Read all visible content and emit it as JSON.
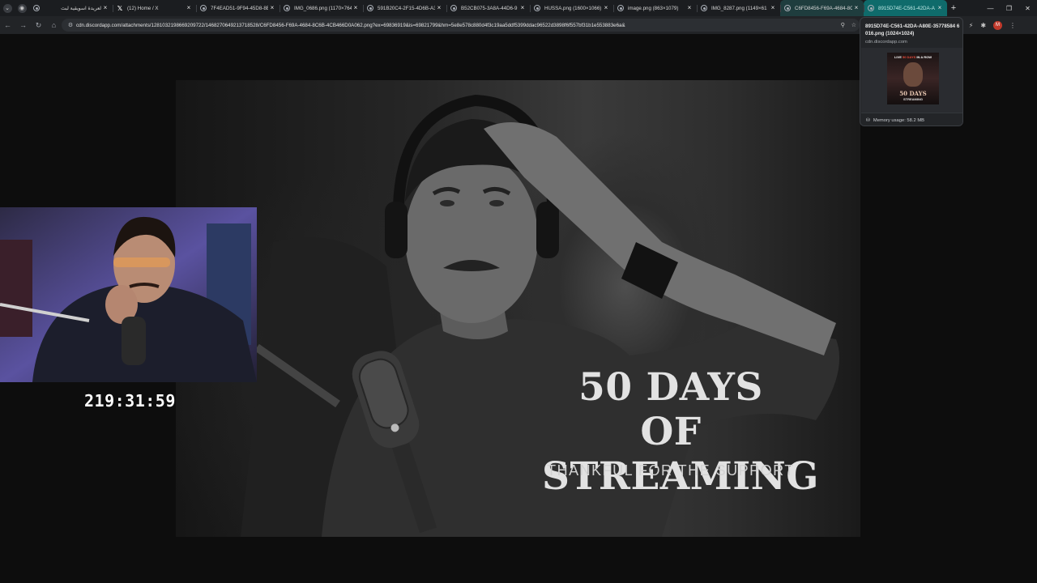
{
  "browser": {
    "tabs": [
      {
        "title": "لعريدة اسويقية لبث",
        "icon": "globe-icon",
        "active": false
      },
      {
        "title": "(12) Home / X",
        "icon": "x-logo-icon",
        "active": false
      },
      {
        "title": "7F4EAD51-9F94-45D8-8E",
        "icon": "globe-icon",
        "active": false
      },
      {
        "title": "IMG_0686.png (1170×764)",
        "icon": "globe-icon",
        "active": false
      },
      {
        "title": "591B20C4-2F15-4D6B-A3",
        "icon": "globe-icon",
        "active": false
      },
      {
        "title": "B52CB075-3A8A-44D6-9",
        "icon": "globe-icon",
        "active": false
      },
      {
        "title": "HUSSA.png (1600×1066)",
        "icon": "globe-icon",
        "active": false
      },
      {
        "title": "image.png (863×1079)",
        "icon": "globe-icon",
        "active": false
      },
      {
        "title": "IMG_8287.png (1149×61",
        "icon": "globe-icon",
        "active": false
      },
      {
        "title": "C6FD8456-F69A-4684-8C",
        "icon": "globe-icon",
        "active": true
      },
      {
        "title": "8915D74E-C561-42DA-A",
        "icon": "globe-icon",
        "active": true
      }
    ],
    "url": "cdn.discordapp.com/attachments/1281032198669209722/1468270649213718528/C6FD8456-F69A-4684-8C6B-4CB466D0A062.png?ex=69836919&is=69821799&hm=5e8e578c880d4f3c19aa5ddf5399ddac96522d3898f6f557bf31b1e553883e6a&",
    "hovercard": {
      "title": "8915D74E-C561-42DA-A80E-35778584 6016.png (1024×1024)",
      "domain": "cdn.discordapp.com",
      "memory": "Memory usage: 58.2 MB",
      "thumb_top": "LIVE",
      "thumb_top_accent": "50 DAYS",
      "thumb_top_rest": "IN A ROW",
      "thumb_title": "50 DAYS",
      "thumb_sub": "STREAMING"
    }
  },
  "content": {
    "image_title_line1": "50 DAYS OF",
    "image_title_line2": "STREAMING",
    "image_subtitle": "THANKFUL FOR THE SUPPORT",
    "stream_timer": "219:31:59"
  }
}
